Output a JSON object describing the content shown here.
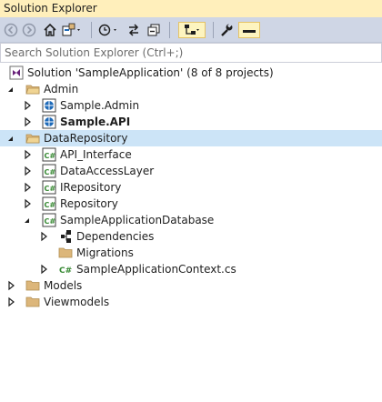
{
  "window": {
    "title": "Solution Explorer"
  },
  "toolbar": {
    "icons": [
      "back-icon",
      "forward-icon",
      "home-icon",
      "switch-views-icon",
      "pending-changes-icon",
      "sync-icon",
      "collapse-all-icon",
      "show-all-files-icon",
      "properties-icon",
      "preview-icon"
    ]
  },
  "search": {
    "placeholder": "Search Solution Explorer (Ctrl+;)",
    "value": ""
  },
  "tree": {
    "solution": "Solution 'SampleApplication' (8 of 8 projects)",
    "admin": "Admin",
    "sample_admin": "Sample.Admin",
    "sample_api": "Sample.API",
    "data_repository": "DataRepository",
    "api_interface": "API_Interface",
    "data_access_layer": "DataAccessLayer",
    "irepository": "IRepository",
    "repository": "Repository",
    "sample_app_db": "SampleApplicationDatabase",
    "dependencies": "Dependencies",
    "migrations": "Migrations",
    "sample_app_context": "SampleApplicationContext.cs",
    "models": "Models",
    "viewmodels": "Viewmodels"
  },
  "colors": {
    "title_bg": "#ffefbb",
    "toolbar_bg": "#cfd6e5",
    "selection": "#cce4f7",
    "folder": "#dcb67a",
    "csharp_project": "#388a34",
    "web_project": "#1e6ab8"
  }
}
